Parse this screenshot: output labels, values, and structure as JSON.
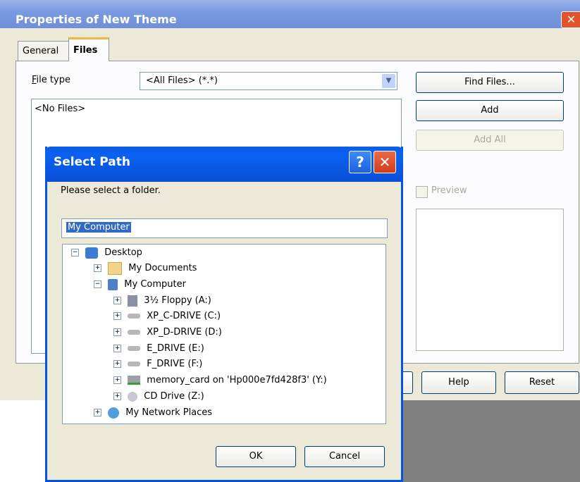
{
  "outer_window": {
    "title": "Properties of New Theme",
    "tabs": [
      "General",
      "Files"
    ],
    "file_type_label": "File type",
    "file_type_value": "<All Files> (*.*)",
    "files_list_placeholder": "<No Files>",
    "find_files_button": "Find Files...",
    "add_button": "Add",
    "add_all_button": "Add All",
    "preview_label": "Preview",
    "help_button": "Help",
    "reset_button": "Reset"
  },
  "dialog": {
    "title": "Select Path",
    "prompt": "Please select a folder.",
    "path_value": "My Computer",
    "tree": {
      "desktop": "Desktop",
      "my_documents": "My Documents",
      "my_computer": "My Computer",
      "floppy": "3½ Floppy (A:)",
      "c_drive": "XP_C-DRIVE (C:)",
      "d_drive": "XP_D-DRIVE (D:)",
      "e_drive": "E_DRIVE (E:)",
      "f_drive": "F_DRIVE (F:)",
      "memory_card": "memory_card on 'Hp000e7fd428f3' (Y:)",
      "cd_drive": "CD Drive (Z:)",
      "network": "My Network Places"
    },
    "ok_button": "OK",
    "cancel_button": "Cancel"
  },
  "colors": {
    "title_blue": "#0a5fe8",
    "selection": "#316ac5",
    "window_bg": "#ece9d8"
  }
}
